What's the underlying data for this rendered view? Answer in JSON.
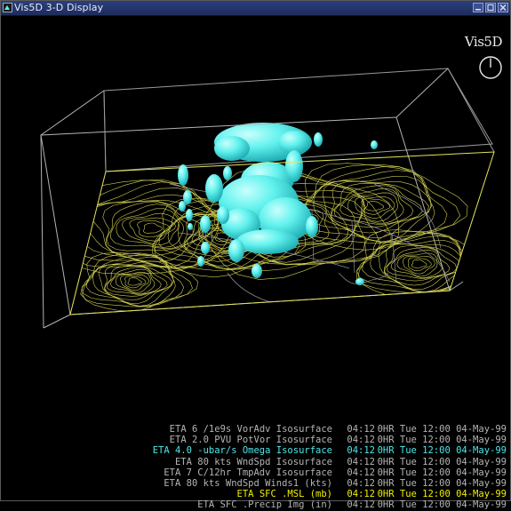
{
  "window": {
    "title": "Vis5D 3-D Display"
  },
  "display": {
    "logo": "Vis5D",
    "clock_icon": "clock-icon",
    "colors": {
      "box": "#c8c8c8",
      "contours": "#e6e45a",
      "isosurface": "#5ef0ec",
      "background": "#000000"
    }
  },
  "legend": [
    {
      "name": "ETA 6 /1e9s VorAdv Isosurface",
      "time": "04:12",
      "date": "0HR Tue 12:00 04-May-99",
      "color": "#b4b4b4"
    },
    {
      "name": "ETA 2.0 PVU PotVor Isosurface",
      "time": "04:12",
      "date": "0HR Tue 12:00 04-May-99",
      "color": "#b4b4b4"
    },
    {
      "name": "ETA 4.0 -ubar/s Omega Isosurface",
      "time": "04:12",
      "date": "0HR Tue 12:00 04-May-99",
      "color": "#4fe6ea"
    },
    {
      "name": "ETA 80 kts WndSpd Isosurface",
      "time": "04:12",
      "date": "0HR Tue 12:00 04-May-99",
      "color": "#b4b4b4"
    },
    {
      "name": "ETA 7 C/12hr TmpAdv Isosurface",
      "time": "04:12",
      "date": "0HR Tue 12:00 04-May-99",
      "color": "#b4b4b4"
    },
    {
      "name": "ETA 80 kts WndSpd Winds1 (kts)",
      "time": "04:12",
      "date": "0HR Tue 12:00 04-May-99",
      "color": "#b4b4b4"
    },
    {
      "name": "ETA SFC .MSL (mb)",
      "time": "04:12",
      "date": "0HR Tue 12:00 04-May-99",
      "color": "#f0f000"
    },
    {
      "name": "ETA SFC .Precip Img (in)",
      "time": "04:12",
      "date": "0HR Tue 12:00 04-May-99",
      "color": "#b4b4b4"
    }
  ]
}
